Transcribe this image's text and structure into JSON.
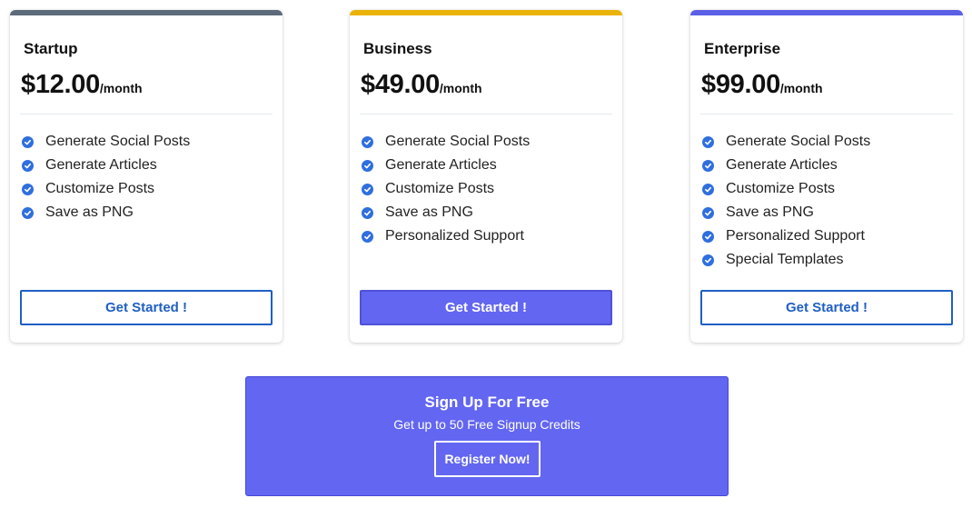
{
  "plans": [
    {
      "name": "Startup",
      "price": "$12.00",
      "period": "/month",
      "accent": "#5d6a7a",
      "features": [
        "Generate Social Posts",
        "Generate Articles",
        "Customize Posts",
        "Save as PNG"
      ],
      "cta_label": "Get Started !",
      "cta_style": "outline"
    },
    {
      "name": "Business",
      "price": "$49.00",
      "period": "/month",
      "accent": "#eab308",
      "features": [
        "Generate Social Posts",
        "Generate Articles",
        "Customize Posts",
        "Save as PNG",
        "Personalized Support"
      ],
      "cta_label": "Get Started !",
      "cta_style": "filled"
    },
    {
      "name": "Enterprise",
      "price": "$99.00",
      "period": "/month",
      "accent": "#5b5fe6",
      "features": [
        "Generate Social Posts",
        "Generate Articles",
        "Customize Posts",
        "Save as PNG",
        "Personalized Support",
        "Special Templates"
      ],
      "cta_label": "Get Started !",
      "cta_style": "outline"
    }
  ],
  "feature_icon": "check-circle-icon",
  "colors": {
    "primary": "#6366f1",
    "link_blue": "#1f5fc4",
    "check_blue": "#2f6fde"
  },
  "signup": {
    "title": "Sign Up For Free",
    "subtitle": "Get up to 50 Free Signup Credits",
    "button_label": "Register Now!"
  }
}
